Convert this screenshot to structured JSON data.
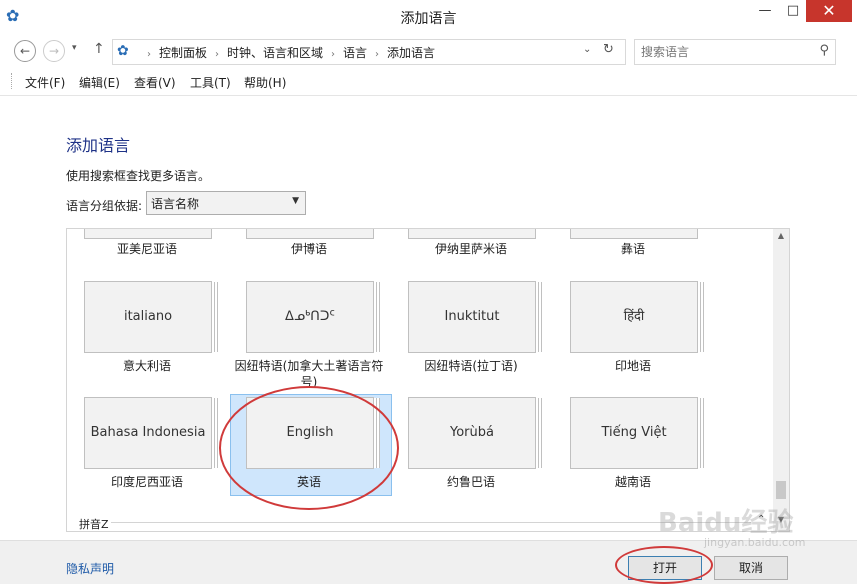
{
  "window": {
    "title": "添加语言",
    "minimize": "—",
    "maximize": "□",
    "close": "✕"
  },
  "nav": {
    "back": "←",
    "forward": "→",
    "recent": "▾",
    "up": "↑",
    "breadcrumbs": [
      "控制面板",
      "时钟、语言和区域",
      "语言",
      "添加语言"
    ],
    "refresh": "↻",
    "dropdown": "⌄"
  },
  "search": {
    "placeholder": "搜索语言"
  },
  "menu": [
    "文件(F)",
    "编辑(E)",
    "查看(V)",
    "工具(T)",
    "帮助(H)"
  ],
  "content": {
    "heading": "添加语言",
    "hint": "使用搜索框查找更多语言。",
    "group_label": "语言分组依据:",
    "group_value": "语言名称"
  },
  "languages_row0": [
    {
      "native": "",
      "name": "亚美尼亚语"
    },
    {
      "native": "",
      "name": "伊博语"
    },
    {
      "native": "",
      "name": "伊纳里萨米语"
    },
    {
      "native": "",
      "name": "彝语"
    }
  ],
  "languages_row1": [
    {
      "native": "italiano",
      "name": "意大利语"
    },
    {
      "native": "ᐃᓄᒃᑎᑐᑦ",
      "name": "因纽特语(加拿大土著语言符号)"
    },
    {
      "native": "Inuktitut",
      "name": "因纽特语(拉丁语)"
    },
    {
      "native": "हिंदी",
      "name": "印地语"
    }
  ],
  "languages_row2": [
    {
      "native": "Bahasa Indonesia",
      "name": "印度尼西亚语"
    },
    {
      "native": "English",
      "name": "英语",
      "selected": true
    },
    {
      "native": "Yorùbá",
      "name": "约鲁巴语"
    },
    {
      "native": "Tiếng Việt",
      "name": "越南语"
    }
  ],
  "group_footer": "拼音Z",
  "footer": {
    "privacy": "隐私声明",
    "open": "打开",
    "cancel": "取消"
  },
  "watermark": "Baidu经验",
  "watermark_url": "jingyan.baidu.com"
}
